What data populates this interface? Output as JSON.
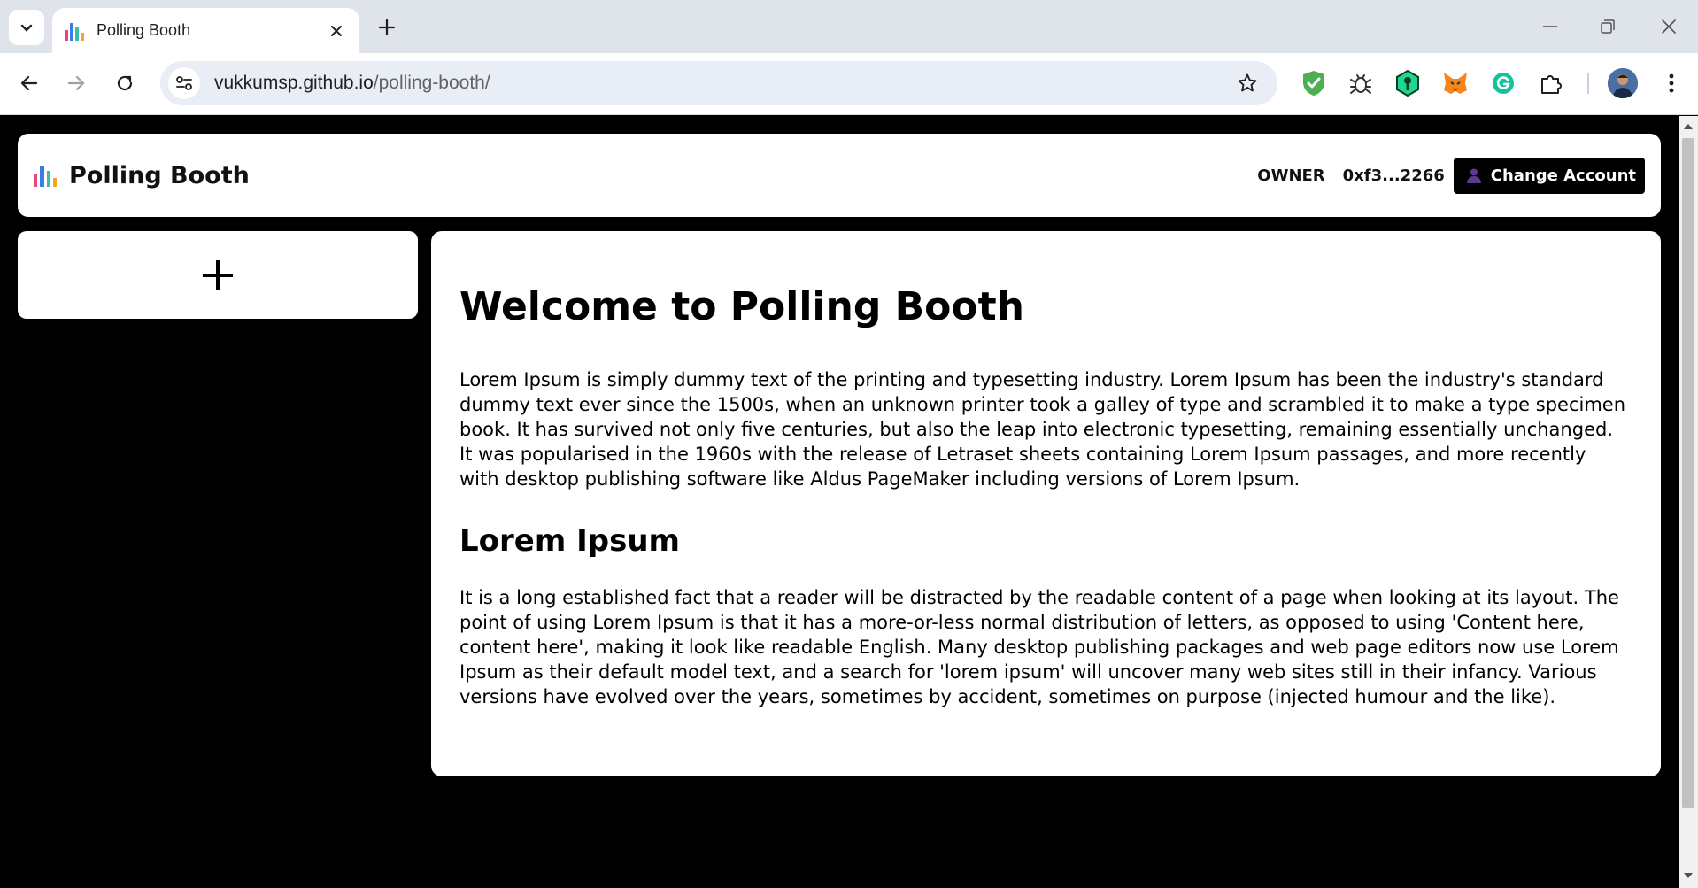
{
  "browser": {
    "tab_title": "Polling Booth",
    "url_host": "vukkumsp.github.io",
    "url_path": "/polling-booth/",
    "icons": [
      "tab-search-icon",
      "close-icon",
      "plus-icon",
      "minimize-icon",
      "restore-icon",
      "window-close-icon",
      "back-arrow-icon",
      "forward-arrow-icon",
      "reload-icon",
      "site-settings-icon",
      "star-icon",
      "shield-extension-icon",
      "bug-extension-icon",
      "hexagon-extension-icon",
      "metamask-fox-icon",
      "grammarly-icon",
      "puzzle-extensions-icon",
      "profile-avatar",
      "more-vert-icon"
    ]
  },
  "app": {
    "title": "Polling Booth",
    "owner_label": "OWNER",
    "owner_address": "0xf3...2266",
    "change_account_label": "Change Account"
  },
  "main": {
    "heading": "Welcome to Polling Booth",
    "intro": "Lorem Ipsum is simply dummy text of the printing and typesetting industry. Lorem Ipsum has been the industry's standard dummy text ever since the 1500s, when an unknown printer took a galley of type and scrambled it to make a type specimen book. It has survived not only five centuries, but also the leap into electronic typesetting, remaining essentially unchanged. It was popularised in the 1960s with the release of Letraset sheets containing Lorem Ipsum passages, and more recently with desktop publishing software like Aldus PageMaker including versions of Lorem Ipsum.",
    "subheading": "Lorem Ipsum",
    "body": "It is a long established fact that a reader will be distracted by the readable content of a page when looking at its layout. The point of using Lorem Ipsum is that it has a more-or-less normal distribution of letters, as opposed to using 'Content here, content here', making it look like readable English. Many desktop publishing packages and web page editors now use Lorem Ipsum as their default model text, and a search for 'lorem ipsum' will uncover many web sites still in their infancy. Various versions have evolved over the years, sometimes by accident, sometimes on purpose (injected humour and the like)."
  },
  "colors": {
    "page_background": "#000000",
    "card_background": "#ffffff",
    "button_background": "#000000"
  }
}
